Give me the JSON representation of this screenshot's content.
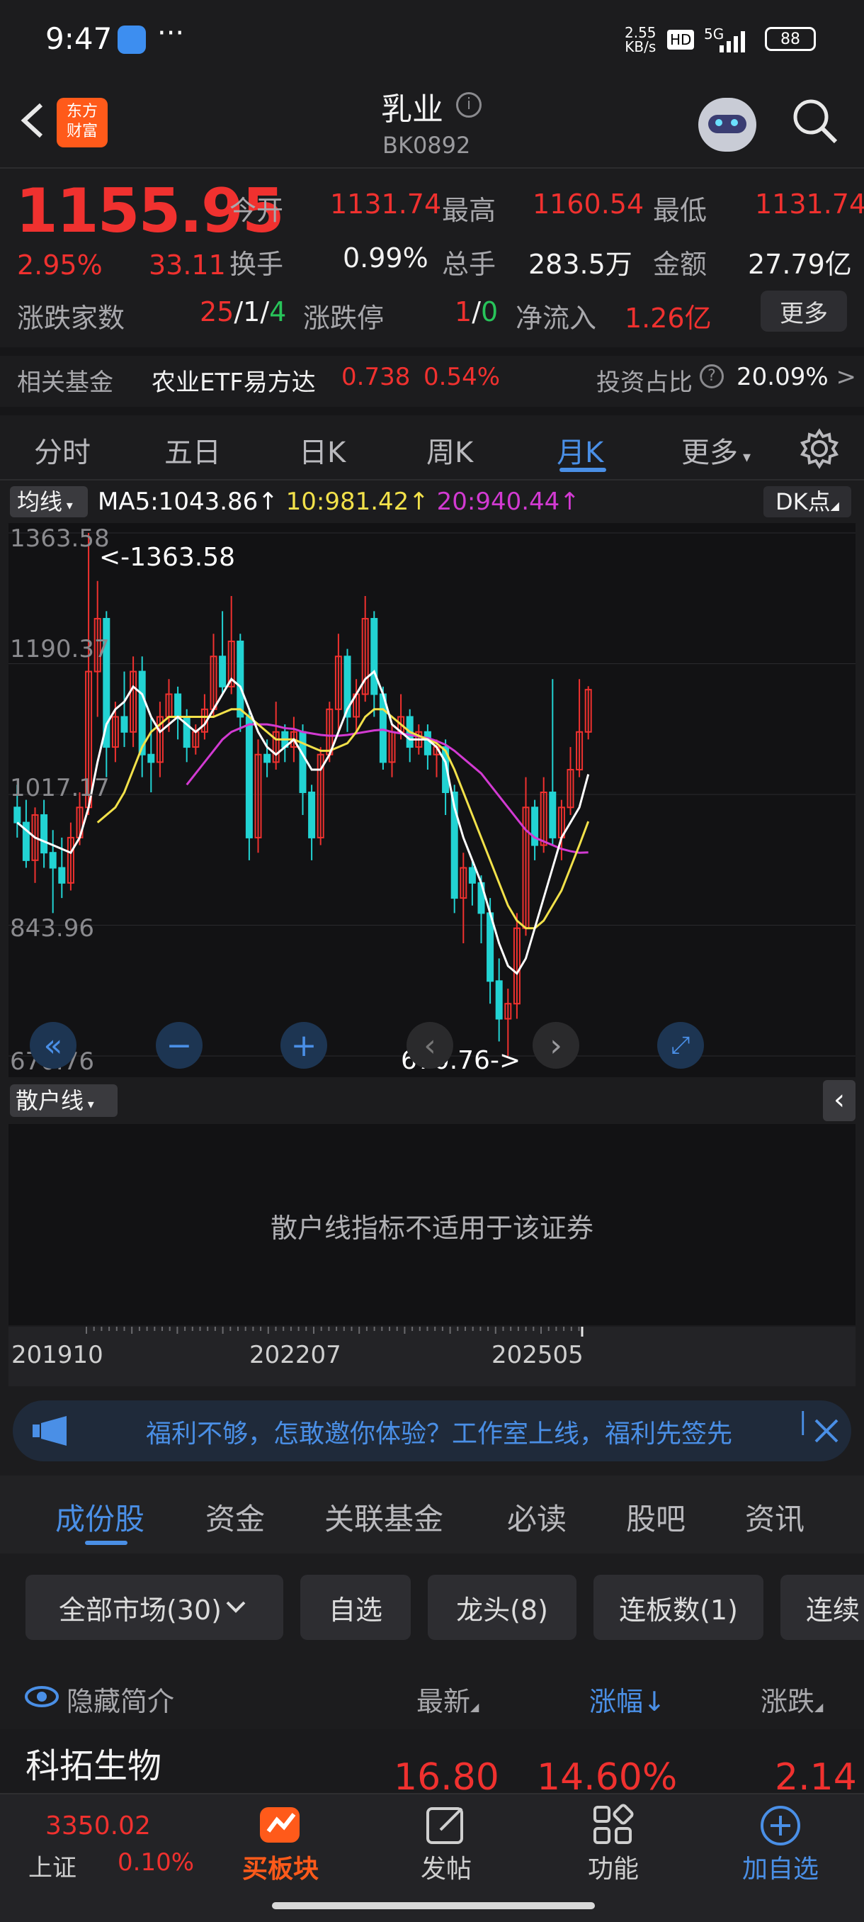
{
  "status_bar": {
    "time": "9:47",
    "dots": "···",
    "speed_top": "2.55",
    "speed_bottom": "KB/s",
    "hd": "HD",
    "signal": "5G",
    "battery": "88"
  },
  "header": {
    "back_icon": "chevron-left-icon",
    "logo_text_1": "东方",
    "logo_text_2": "财富",
    "title": "乳业",
    "code": "BK0892"
  },
  "quote": {
    "price": "1155.95",
    "change_pct": "2.95%",
    "change": "33.11",
    "open_label": "今开",
    "open": "1131.74",
    "high_label": "最高",
    "high": "1160.54",
    "low_label": "最低",
    "low": "1131.74",
    "turnover_label": "换手",
    "turnover": "0.99%",
    "volume_label": "总手",
    "volume": "283.5万",
    "amount_label": "金额",
    "amount": "27.79亿",
    "updown_label": "涨跌家数",
    "up": "25",
    "flat": "1",
    "down": "4",
    "slash": "/",
    "limit_label": "涨跌停",
    "limit_up": "1",
    "limit_down": "0",
    "inflow_label": "净流入",
    "inflow": "1.26亿",
    "more": "更多"
  },
  "fund": {
    "label": "相关基金",
    "name": "农业ETF易方达",
    "price": "0.738",
    "pct": "0.54%",
    "ratio_label": "投资占比",
    "ratio": "20.09%",
    "arrow": ">"
  },
  "period_tabs": [
    "分时",
    "五日",
    "日K",
    "周K",
    "月K",
    "更多"
  ],
  "active_period": 4,
  "ma": {
    "selector": "均线",
    "ma5": "MA5:1043.86",
    "ma10": "10:981.42",
    "ma20": "20:940.44",
    "arrow": "↑",
    "dk": "DK点"
  },
  "chart_data": {
    "type": "candlestick",
    "ylabels": [
      "1363.58",
      "1190.37",
      "1017.17",
      "843.96",
      "670.76"
    ],
    "max_label": "<-1363.58",
    "min_label": "670.76->",
    "ylim": [
      670.76,
      1363.58
    ],
    "candles": [
      [
        1000,
        980,
        1030,
        960
      ],
      [
        980,
        930,
        1010,
        920
      ],
      [
        930,
        990,
        1000,
        900
      ],
      [
        990,
        940,
        1010,
        920
      ],
      [
        940,
        920,
        970,
        860
      ],
      [
        920,
        900,
        960,
        880
      ],
      [
        900,
        960,
        980,
        890
      ],
      [
        960,
        1000,
        1020,
        950
      ],
      [
        1000,
        1180,
        1363.58,
        990
      ],
      [
        1180,
        1250,
        1300,
        1120
      ],
      [
        1250,
        1080,
        1260,
        1040
      ],
      [
        1080,
        1120,
        1140,
        1060
      ],
      [
        1120,
        1100,
        1180,
        1080
      ],
      [
        1100,
        1180,
        1200,
        1080
      ],
      [
        1180,
        1070,
        1200,
        1040
      ],
      [
        1070,
        1060,
        1120,
        1020
      ],
      [
        1060,
        1120,
        1140,
        1040
      ],
      [
        1120,
        1150,
        1170,
        1100
      ],
      [
        1150,
        1120,
        1160,
        1090
      ],
      [
        1120,
        1080,
        1130,
        1060
      ],
      [
        1080,
        1100,
        1110,
        1070
      ],
      [
        1100,
        1130,
        1150,
        1090
      ],
      [
        1130,
        1200,
        1230,
        1120
      ],
      [
        1200,
        1160,
        1260,
        1150
      ],
      [
        1160,
        1220,
        1280,
        1150
      ],
      [
        1220,
        1120,
        1230,
        1100
      ],
      [
        1120,
        960,
        1130,
        930
      ],
      [
        960,
        1070,
        1090,
        940
      ],
      [
        1070,
        1060,
        1090,
        1040
      ],
      [
        1060,
        1100,
        1140,
        1050
      ],
      [
        1100,
        1080,
        1110,
        1060
      ],
      [
        1080,
        1100,
        1120,
        1060
      ],
      [
        1100,
        1020,
        1110,
        990
      ],
      [
        1020,
        960,
        1030,
        930
      ],
      [
        960,
        1070,
        1080,
        950
      ],
      [
        1070,
        1130,
        1140,
        1060
      ],
      [
        1130,
        1200,
        1230,
        1100
      ],
      [
        1200,
        1120,
        1210,
        1100
      ],
      [
        1120,
        1150,
        1170,
        1100
      ],
      [
        1150,
        1250,
        1280,
        1140
      ],
      [
        1250,
        1150,
        1260,
        1120
      ],
      [
        1150,
        1060,
        1160,
        1050
      ],
      [
        1060,
        1100,
        1110,
        1040
      ],
      [
        1100,
        1120,
        1150,
        1090
      ],
      [
        1120,
        1080,
        1130,
        1060
      ],
      [
        1080,
        1100,
        1110,
        1070
      ],
      [
        1100,
        1070,
        1110,
        1050
      ],
      [
        1070,
        1080,
        1090,
        1040
      ],
      [
        1080,
        1020,
        1090,
        990
      ],
      [
        1020,
        880,
        1030,
        860
      ],
      [
        880,
        920,
        940,
        820
      ],
      [
        920,
        900,
        930,
        870
      ],
      [
        900,
        860,
        910,
        820
      ],
      [
        860,
        770,
        880,
        740
      ],
      [
        770,
        720,
        800,
        690
      ],
      [
        720,
        740,
        760,
        670.76
      ],
      [
        740,
        840,
        860,
        720
      ],
      [
        840,
        1000,
        1040,
        830
      ],
      [
        1000,
        950,
        1010,
        930
      ],
      [
        950,
        1020,
        1040,
        940
      ],
      [
        1020,
        960,
        1170,
        950
      ],
      [
        960,
        1000,
        1010,
        930
      ],
      [
        1000,
        1050,
        1080,
        990
      ],
      [
        1050,
        1100,
        1170,
        1040
      ],
      [
        1100,
        1155.95,
        1160.54,
        1090
      ]
    ],
    "ma5": [
      980,
      970,
      960,
      955,
      950,
      945,
      940,
      960,
      1000,
      1060,
      1110,
      1130,
      1140,
      1160,
      1150,
      1120,
      1100,
      1110,
      1120,
      1110,
      1100,
      1110,
      1130,
      1150,
      1170,
      1160,
      1130,
      1100,
      1080,
      1070,
      1080,
      1090,
      1070,
      1050,
      1050,
      1070,
      1100,
      1130,
      1150,
      1170,
      1180,
      1150,
      1110,
      1100,
      1090,
      1090,
      1090,
      1080,
      1060,
      1000,
      960,
      930,
      900,
      860,
      820,
      790,
      780,
      800,
      840,
      880,
      920,
      960,
      980,
      1000,
      1043.86
    ],
    "ma10": [
      null,
      null,
      null,
      null,
      null,
      null,
      null,
      null,
      null,
      980,
      990,
      1000,
      1020,
      1050,
      1080,
      1100,
      1110,
      1120,
      1120,
      1120,
      1120,
      1120,
      1120,
      1125,
      1130,
      1130,
      1120,
      1110,
      1100,
      1090,
      1090,
      1090,
      1085,
      1080,
      1075,
      1075,
      1080,
      1085,
      1100,
      1120,
      1130,
      1130,
      1120,
      1110,
      1100,
      1095,
      1090,
      1085,
      1075,
      1050,
      1020,
      990,
      960,
      930,
      900,
      870,
      850,
      840,
      840,
      850,
      870,
      890,
      920,
      950,
      981.42
    ],
    "ma20": [
      null,
      null,
      null,
      null,
      null,
      null,
      null,
      null,
      null,
      null,
      null,
      null,
      null,
      null,
      null,
      null,
      null,
      null,
      null,
      1030,
      1045,
      1060,
      1075,
      1090,
      1100,
      1105,
      1110,
      1110,
      1110,
      1108,
      1105,
      1104,
      1100,
      1098,
      1096,
      1095,
      1095,
      1096,
      1098,
      1100,
      1102,
      1103,
      1100,
      1098,
      1096,
      1094,
      1092,
      1088,
      1083,
      1075,
      1065,
      1055,
      1045,
      1030,
      1015,
      1000,
      985,
      970,
      960,
      955,
      950,
      945,
      942,
      940,
      940.44
    ]
  },
  "sub_indicator": {
    "selector": "散户线",
    "message": "散户线指标不适用于该证券"
  },
  "timeline": [
    "201910",
    "202207",
    "202505"
  ],
  "banner": {
    "text": "福利不够，怎敢邀你体验？工作室上线，福利先签先"
  },
  "content_tabs": [
    "成份股",
    "资金",
    "关联基金",
    "必读",
    "股吧",
    "资讯"
  ],
  "filters": [
    "全部市场(30)",
    "自选",
    "龙头(8)",
    "连板数(1)",
    "连续"
  ],
  "list_header": {
    "hide": "隐藏简介",
    "latest": "最新",
    "pct": "涨幅",
    "pct_arrow": "↓",
    "change": "涨跌"
  },
  "rows": [
    {
      "name": "科拓生物",
      "latest": "16.80",
      "pct": "14.60%",
      "change": "2.14"
    }
  ],
  "bottom_nav": {
    "index_value": "3350.02",
    "index_name": "上证",
    "index_pct": "0.10%",
    "items": [
      "买板块",
      "发帖",
      "功能",
      "加自选"
    ]
  },
  "colors": {
    "up": "#f0312f",
    "down": "#28c45a",
    "accent": "#4a8fe6",
    "ma5": "#ffffff",
    "ma10": "#f2e14a",
    "ma20": "#d23ad2"
  }
}
